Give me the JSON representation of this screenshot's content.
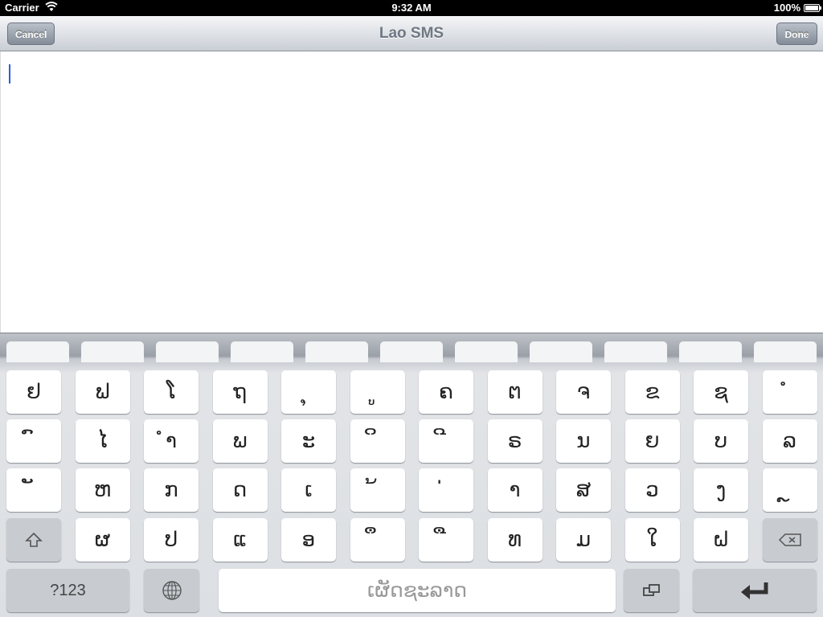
{
  "status_bar": {
    "carrier": "Carrier",
    "time": "9:32 AM",
    "battery": "100%",
    "battery_level": 1.0
  },
  "nav_bar": {
    "title": "Lao SMS",
    "cancel_label": "Cancel",
    "done_label": "Done"
  },
  "text_area": {
    "value": ""
  },
  "keyboard": {
    "rows": [
      [
        "ຢ",
        "ຟ",
        "ໂ",
        "ຖ",
        "ຸ",
        "ູ",
        "ຄ",
        "ຕ",
        "ຈ",
        "ຂ",
        "ຊ",
        "ໍ"
      ],
      [
        "ົ",
        "ໄ",
        "ຳ",
        "ພ",
        "ະ",
        "ິ",
        "ີ",
        "ຣ",
        "ນ",
        "ຍ",
        "ບ",
        "ລ"
      ],
      [
        "ັ",
        "ຫ",
        "ກ",
        "ດ",
        "ເ",
        "້",
        "່",
        "າ",
        "ສ",
        "ວ",
        "ງ",
        "ຼ"
      ],
      [
        "ຜ",
        "ປ",
        "ແ",
        "ອ",
        "ຶ",
        "ື",
        "ທ",
        "ມ",
        "ໃ",
        "ຝ"
      ]
    ],
    "numbers_label": "?123",
    "space_label": "ເຜັດຊະລາດ",
    "icons": {
      "shift": "shift-icon",
      "delete": "delete-icon",
      "globe": "globe-icon",
      "hide_keyboard": "keyboard-hide-icon",
      "return": "return-icon"
    },
    "colors": {
      "key": "#ffffff",
      "special_key": "#c8ccd1",
      "caret": "#2d5ee0"
    }
  }
}
